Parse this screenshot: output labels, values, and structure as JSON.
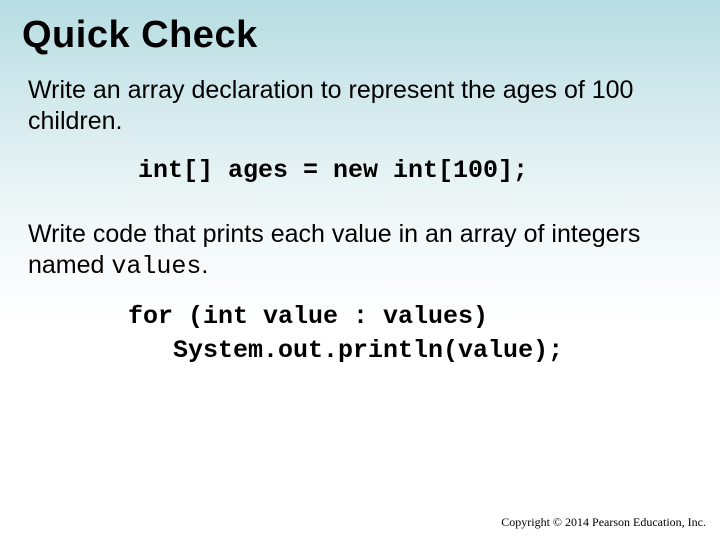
{
  "title": "Quick Check",
  "prompt1": "Write an array declaration to represent the ages of 100 children.",
  "code1": "int[] ages = new int[100];",
  "prompt2_pre": "Write code that prints each value in an array of integers named ",
  "prompt2_mono": "values",
  "prompt2_post": ".",
  "code2": "for (int value : values)\n   System.out.println(value);",
  "footer": "Copyright © 2014 Pearson Education, Inc."
}
